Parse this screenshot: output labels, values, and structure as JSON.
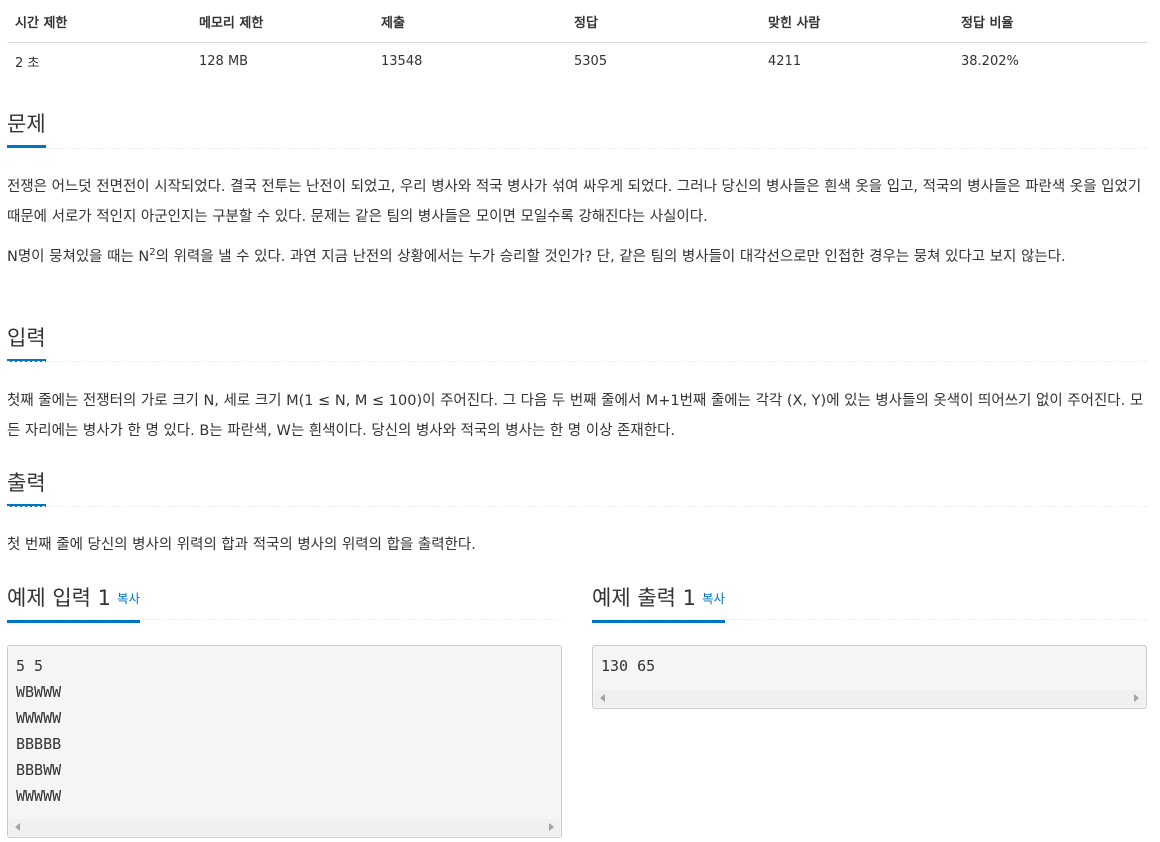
{
  "stats": {
    "headers": [
      "시간 제한",
      "메모리 제한",
      "제출",
      "정답",
      "맞힌 사람",
      "정답 비율"
    ],
    "values": [
      "2 초",
      "128 MB",
      "13548",
      "5305",
      "4211",
      "38.202%"
    ]
  },
  "problem": {
    "title": "문제",
    "p1": "전쟁은 어느덧 전면전이 시작되었다. 결국 전투는 난전이 되었고, 우리 병사와 적국 병사가 섞여 싸우게 되었다. 그러나 당신의 병사들은 흰색 옷을 입고, 적국의 병사들은 파란색 옷을 입었기 때문에 서로가 적인지 아군인지는 구분할 수 있다. 문제는 같은 팀의 병사들은 모이면 모일수록 강해진다는 사실이다.",
    "p2_before": "N명이 뭉쳐있을 때는 N",
    "p2_sup": "2",
    "p2_after": "의 위력을 낼 수 있다. 과연 지금 난전의 상황에서는 누가 승리할 것인가? 단, 같은 팀의 병사들이 대각선으로만 인접한 경우는 뭉쳐 있다고 보지 않는다."
  },
  "input": {
    "title": "입력",
    "text": "첫째 줄에는 전쟁터의 가로 크기 N, 세로 크기 M(1 ≤ N, M ≤ 100)이 주어진다. 그 다음 두 번째 줄에서 M+1번째 줄에는 각각 (X, Y)에 있는 병사들의 옷색이 띄어쓰기 없이 주어진다. 모든 자리에는 병사가 한 명 있다. B는 파란색, W는 흰색이다. 당신의 병사와 적국의 병사는 한 명 이상 존재한다."
  },
  "output": {
    "title": "출력",
    "text": "첫 번째 줄에 당신의 병사의 위력의 합과 적국의 병사의 위력의 합을 출력한다."
  },
  "sample_input": {
    "title": "예제 입력 1",
    "copy": "복사",
    "content": "5 5\nWBWWW\nWWWWW\nBBBBB\nBBBWW\nWWWWW"
  },
  "sample_output": {
    "title": "예제 출력 1",
    "copy": "복사",
    "content": "130 65"
  }
}
